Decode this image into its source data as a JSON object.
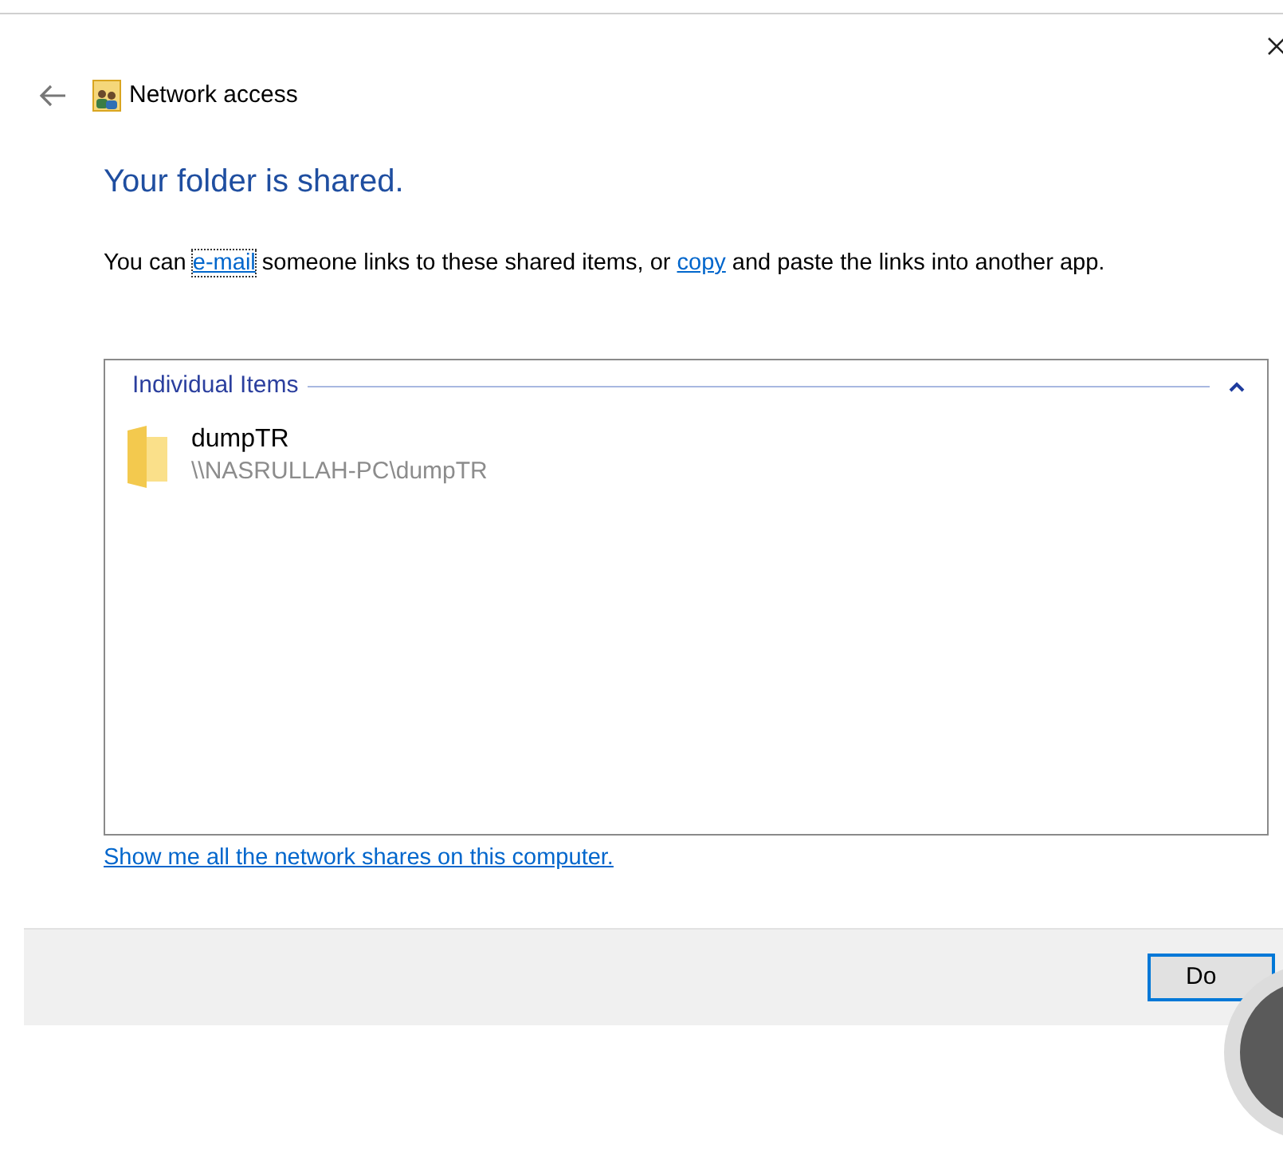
{
  "window": {
    "title": "Network access"
  },
  "heading": "Your folder is shared.",
  "message": [
    {
      "kind": "text",
      "text": "You can "
    },
    {
      "kind": "link",
      "text": "e-mail",
      "focused": true
    },
    {
      "kind": "text",
      "text": " someone links to these shared items, or "
    },
    {
      "kind": "link",
      "text": "copy",
      "focused": false
    },
    {
      "kind": "text",
      "text": " and paste the links into another app."
    }
  ],
  "group": {
    "title": "Individual Items",
    "expanded": true,
    "items": [
      {
        "name": "dumpTR",
        "path": "\\\\NASRULLAH-PC\\dumpTR"
      }
    ]
  },
  "shares_link": "Show me all the network shares on this computer.",
  "buttons": [
    {
      "label": "Do",
      "default": true
    }
  ]
}
